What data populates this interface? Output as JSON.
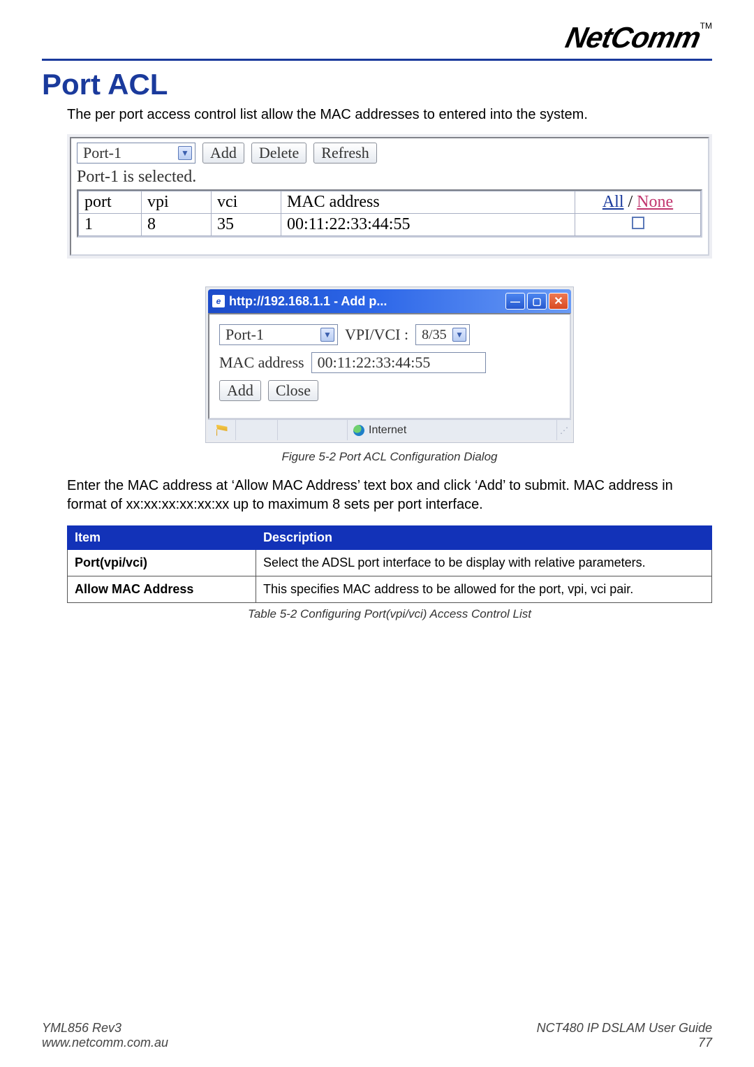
{
  "brand": {
    "name": "NetComm",
    "tm": "TM"
  },
  "heading": "Port ACL",
  "intro": "The per port access control list allow the MAC addresses to entered into the system.",
  "shot1": {
    "port_select": "Port-1",
    "buttons": {
      "add": "Add",
      "delete": "Delete",
      "refresh": "Refresh"
    },
    "status": "Port-1 is selected.",
    "headers": {
      "port": "port",
      "vpi": "vpi",
      "vci": "vci",
      "mac": "MAC address",
      "all": "All",
      "none": "None",
      "sep": " / "
    },
    "row": {
      "port": "1",
      "vpi": "8",
      "vci": "35",
      "mac": "00:11:22:33:44:55"
    }
  },
  "shot2": {
    "title": "http://192.168.1.1 - Add p...",
    "port_select": "Port-1",
    "vpivci_label": "VPI/VCI :",
    "vpivci_value": "8/35",
    "mac_label": "MAC address",
    "mac_value": "00:11:22:33:44:55",
    "buttons": {
      "add": "Add",
      "close": "Close"
    },
    "zone": "Internet"
  },
  "fig_caption": "Figure 5-2 Port ACL Configuration Dialog",
  "para2": "Enter the MAC address at ‘Allow MAC Address’ text box and click ‘Add’ to submit. MAC address in format of xx:xx:xx:xx:xx:xx up to maximum 8 sets per port interface.",
  "desc_table": {
    "headers": {
      "item": "Item",
      "desc": "Description"
    },
    "rows": [
      {
        "item": "Port(vpi/vci)",
        "desc": "Select the ADSL port interface to be display with relative parameters."
      },
      {
        "item": "Allow MAC Address",
        "desc": "This specifies MAC address to be allowed for the port, vpi, vci pair."
      }
    ]
  },
  "tbl_caption": "Table 5-2 Configuring Port(vpi/vci) Access Control List",
  "footer": {
    "rev": "YML856 Rev3",
    "url": "www.netcomm.com.au",
    "guide": "NCT480 IP DSLAM User Guide",
    "page": "77"
  }
}
